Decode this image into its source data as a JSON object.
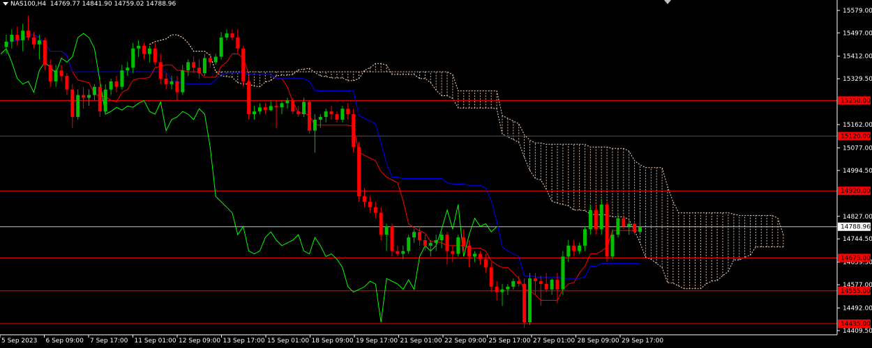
{
  "header": {
    "symbol": "NAS100,H4",
    "ohlc": "14769.77 14841.90 14759.02 14788.96"
  },
  "icons": {
    "collapse": "triangle-down-icon",
    "scroll": "scroll-indicator-icon"
  },
  "colors": {
    "background": "#000000",
    "frame": "#ffffff",
    "bull": "#00c000",
    "bear": "#ff0000",
    "tenkan": "#ff0000",
    "kijun": "#0000ff",
    "chikou": "#00ff00",
    "cloud": "#ffdab9",
    "level": "#ff0000",
    "current": "#ffffff"
  },
  "chart_data": {
    "type": "candlestick",
    "title": "NAS100,H4",
    "indicator": "Ichimoku",
    "grid": false,
    "ylim": [
      14409.5,
      15579.0
    ],
    "y_ticks": [
      "15579.00",
      "15497.00",
      "15412.00",
      "15329.50",
      "15162.00",
      "15077.00",
      "14994.50",
      "14827.00",
      "14744.50",
      "14659.50",
      "14577.00",
      "14492.00",
      "14409.50"
    ],
    "x_ticks": [
      "5 Sep 2023",
      "6 Sep 09:00",
      "7 Sep 17:00",
      "11 Sep 01:00",
      "12 Sep 09:00",
      "13 Sep 17:00",
      "15 Sep 01:00",
      "18 Sep 09:00",
      "19 Sep 17:00",
      "21 Sep 01:00",
      "22 Sep 09:00",
      "25 Sep 17:00",
      "27 Sep 01:00",
      "28 Sep 09:00",
      "29 Sep 17:00"
    ],
    "levels": [
      {
        "label": "15250.00",
        "value": 15250.0
      },
      {
        "label": "15120.00",
        "value": 15120.0
      },
      {
        "label": "14920.00",
        "value": 14920.0
      },
      {
        "label": "14675.00",
        "value": 14675.0
      },
      {
        "label": "14555.00",
        "value": 14555.0
      },
      {
        "label": "14435.00",
        "value": 14435.0
      }
    ],
    "current_price": {
      "label": "14788.96",
      "value": 14788.96
    },
    "bars": [
      {
        "o": 15445,
        "h": 15490,
        "l": 15420,
        "c": 15465
      },
      {
        "o": 15465,
        "h": 15510,
        "l": 15440,
        "c": 15490
      },
      {
        "o": 15490,
        "h": 15520,
        "l": 15450,
        "c": 15470
      },
      {
        "o": 15470,
        "h": 15530,
        "l": 15430,
        "c": 15505
      },
      {
        "o": 15505,
        "h": 15560,
        "l": 15470,
        "c": 15480
      },
      {
        "o": 15480,
        "h": 15500,
        "l": 15440,
        "c": 15455
      },
      {
        "o": 15455,
        "h": 15490,
        "l": 15400,
        "c": 15470
      },
      {
        "o": 15470,
        "h": 15480,
        "l": 15360,
        "c": 15380
      },
      {
        "o": 15380,
        "h": 15400,
        "l": 15300,
        "c": 15320
      },
      {
        "o": 15320,
        "h": 15380,
        "l": 15300,
        "c": 15360
      },
      {
        "o": 15360,
        "h": 15380,
        "l": 15320,
        "c": 15340
      },
      {
        "o": 15340,
        "h": 15350,
        "l": 15270,
        "c": 15290
      },
      {
        "o": 15290,
        "h": 15310,
        "l": 15150,
        "c": 15190
      },
      {
        "o": 15190,
        "h": 15290,
        "l": 15180,
        "c": 15270
      },
      {
        "o": 15270,
        "h": 15300,
        "l": 15220,
        "c": 15260
      },
      {
        "o": 15260,
        "h": 15290,
        "l": 15230,
        "c": 15270
      },
      {
        "o": 15270,
        "h": 15310,
        "l": 15250,
        "c": 15300
      },
      {
        "o": 15300,
        "h": 15330,
        "l": 15190,
        "c": 15210
      },
      {
        "o": 15210,
        "h": 15310,
        "l": 15200,
        "c": 15290
      },
      {
        "o": 15290,
        "h": 15330,
        "l": 15270,
        "c": 15320
      },
      {
        "o": 15320,
        "h": 15340,
        "l": 15280,
        "c": 15300
      },
      {
        "o": 15300,
        "h": 15380,
        "l": 15290,
        "c": 15360
      },
      {
        "o": 15360,
        "h": 15390,
        "l": 15340,
        "c": 15370
      },
      {
        "o": 15370,
        "h": 15460,
        "l": 15350,
        "c": 15440
      },
      {
        "o": 15440,
        "h": 15470,
        "l": 15410,
        "c": 15450
      },
      {
        "o": 15450,
        "h": 15460,
        "l": 15400,
        "c": 15420
      },
      {
        "o": 15420,
        "h": 15450,
        "l": 15390,
        "c": 15440
      },
      {
        "o": 15440,
        "h": 15460,
        "l": 15380,
        "c": 15390
      },
      {
        "o": 15390,
        "h": 15420,
        "l": 15310,
        "c": 15330
      },
      {
        "o": 15330,
        "h": 15350,
        "l": 15290,
        "c": 15310
      },
      {
        "o": 15310,
        "h": 15340,
        "l": 15290,
        "c": 15320
      },
      {
        "o": 15320,
        "h": 15340,
        "l": 15250,
        "c": 15280
      },
      {
        "o": 15280,
        "h": 15380,
        "l": 15270,
        "c": 15360
      },
      {
        "o": 15360,
        "h": 15400,
        "l": 15340,
        "c": 15390
      },
      {
        "o": 15390,
        "h": 15410,
        "l": 15350,
        "c": 15370
      },
      {
        "o": 15370,
        "h": 15400,
        "l": 15330,
        "c": 15350
      },
      {
        "o": 15350,
        "h": 15420,
        "l": 15340,
        "c": 15405
      },
      {
        "o": 15405,
        "h": 15420,
        "l": 15370,
        "c": 15390
      },
      {
        "o": 15390,
        "h": 15420,
        "l": 15380,
        "c": 15410
      },
      {
        "o": 15410,
        "h": 15500,
        "l": 15400,
        "c": 15480
      },
      {
        "o": 15480,
        "h": 15510,
        "l": 15470,
        "c": 15495
      },
      {
        "o": 15495,
        "h": 15510,
        "l": 15470,
        "c": 15480
      },
      {
        "o": 15480,
        "h": 15510,
        "l": 15420,
        "c": 15440
      },
      {
        "o": 15440,
        "h": 15450,
        "l": 15300,
        "c": 15320
      },
      {
        "o": 15320,
        "h": 15340,
        "l": 15180,
        "c": 15200
      },
      {
        "o": 15200,
        "h": 15230,
        "l": 15180,
        "c": 15210
      },
      {
        "o": 15210,
        "h": 15240,
        "l": 15200,
        "c": 15225
      },
      {
        "o": 15225,
        "h": 15240,
        "l": 15200,
        "c": 15215
      },
      {
        "o": 15215,
        "h": 15250,
        "l": 15210,
        "c": 15230
      },
      {
        "o": 15230,
        "h": 15250,
        "l": 15150,
        "c": 15225
      },
      {
        "o": 15225,
        "h": 15250,
        "l": 15200,
        "c": 15240
      },
      {
        "o": 15240,
        "h": 15260,
        "l": 15220,
        "c": 15250
      },
      {
        "o": 15250,
        "h": 15260,
        "l": 15200,
        "c": 15210
      },
      {
        "o": 15210,
        "h": 15230,
        "l": 15190,
        "c": 15200
      },
      {
        "o": 15200,
        "h": 15260,
        "l": 15190,
        "c": 15245
      },
      {
        "o": 15245,
        "h": 15250,
        "l": 15130,
        "c": 15140
      },
      {
        "o": 15140,
        "h": 15200,
        "l": 15060,
        "c": 15180
      },
      {
        "o": 15180,
        "h": 15200,
        "l": 15150,
        "c": 15190
      },
      {
        "o": 15190,
        "h": 15220,
        "l": 15170,
        "c": 15210
      },
      {
        "o": 15210,
        "h": 15230,
        "l": 15180,
        "c": 15200
      },
      {
        "o": 15200,
        "h": 15210,
        "l": 15170,
        "c": 15180
      },
      {
        "o": 15180,
        "h": 15230,
        "l": 15170,
        "c": 15220
      },
      {
        "o": 15220,
        "h": 15240,
        "l": 15180,
        "c": 15200
      },
      {
        "o": 15200,
        "h": 15220,
        "l": 15060,
        "c": 15080
      },
      {
        "o": 15080,
        "h": 15100,
        "l": 14880,
        "c": 14900
      },
      {
        "o": 14900,
        "h": 14930,
        "l": 14860,
        "c": 14880
      },
      {
        "o": 14880,
        "h": 14900,
        "l": 14840,
        "c": 14860
      },
      {
        "o": 14860,
        "h": 14880,
        "l": 14820,
        "c": 14840
      },
      {
        "o": 14840,
        "h": 14860,
        "l": 14740,
        "c": 14760
      },
      {
        "o": 14760,
        "h": 14800,
        "l": 14700,
        "c": 14790
      },
      {
        "o": 14790,
        "h": 14800,
        "l": 14680,
        "c": 14700
      },
      {
        "o": 14700,
        "h": 14720,
        "l": 14680,
        "c": 14690
      },
      {
        "o": 14690,
        "h": 14720,
        "l": 14670,
        "c": 14700
      },
      {
        "o": 14700,
        "h": 14760,
        "l": 14690,
        "c": 14750
      },
      {
        "o": 14750,
        "h": 14780,
        "l": 14730,
        "c": 14770
      },
      {
        "o": 14770,
        "h": 14790,
        "l": 14720,
        "c": 14740
      },
      {
        "o": 14740,
        "h": 14760,
        "l": 14700,
        "c": 14720
      },
      {
        "o": 14720,
        "h": 14740,
        "l": 14680,
        "c": 14730
      },
      {
        "o": 14730,
        "h": 14760,
        "l": 14700,
        "c": 14740
      },
      {
        "o": 14740,
        "h": 14770,
        "l": 14710,
        "c": 14760
      },
      {
        "o": 14760,
        "h": 14770,
        "l": 14650,
        "c": 14700
      },
      {
        "o": 14700,
        "h": 14720,
        "l": 14660,
        "c": 14690
      },
      {
        "o": 14690,
        "h": 14760,
        "l": 14680,
        "c": 14750
      },
      {
        "o": 14750,
        "h": 14780,
        "l": 14700,
        "c": 14720
      },
      {
        "o": 14720,
        "h": 14740,
        "l": 14640,
        "c": 14680
      },
      {
        "o": 14680,
        "h": 14700,
        "l": 14660,
        "c": 14690
      },
      {
        "o": 14690,
        "h": 14700,
        "l": 14650,
        "c": 14670
      },
      {
        "o": 14670,
        "h": 14690,
        "l": 14620,
        "c": 14640
      },
      {
        "o": 14640,
        "h": 14660,
        "l": 14550,
        "c": 14570
      },
      {
        "o": 14570,
        "h": 14590,
        "l": 14520,
        "c": 14550
      },
      {
        "o": 14550,
        "h": 14580,
        "l": 14500,
        "c": 14560
      },
      {
        "o": 14560,
        "h": 14580,
        "l": 14540,
        "c": 14570
      },
      {
        "o": 14570,
        "h": 14600,
        "l": 14560,
        "c": 14590
      },
      {
        "o": 14590,
        "h": 14610,
        "l": 14570,
        "c": 14580
      },
      {
        "o": 14580,
        "h": 14600,
        "l": 14420,
        "c": 14440
      },
      {
        "o": 14440,
        "h": 14620,
        "l": 14430,
        "c": 14600
      },
      {
        "o": 14600,
        "h": 14620,
        "l": 14540,
        "c": 14590
      },
      {
        "o": 14590,
        "h": 14610,
        "l": 14500,
        "c": 14580
      },
      {
        "o": 14580,
        "h": 14620,
        "l": 14550,
        "c": 14560
      },
      {
        "o": 14560,
        "h": 14600,
        "l": 14540,
        "c": 14595
      },
      {
        "o": 14595,
        "h": 14620,
        "l": 14510,
        "c": 14560
      },
      {
        "o": 14560,
        "h": 14700,
        "l": 14540,
        "c": 14680
      },
      {
        "o": 14680,
        "h": 14740,
        "l": 14660,
        "c": 14720
      },
      {
        "o": 14720,
        "h": 14740,
        "l": 14680,
        "c": 14700
      },
      {
        "o": 14700,
        "h": 14730,
        "l": 14690,
        "c": 14720
      },
      {
        "o": 14720,
        "h": 14790,
        "l": 14700,
        "c": 14780
      },
      {
        "o": 14780,
        "h": 14870,
        "l": 14760,
        "c": 14850
      },
      {
        "o": 14850,
        "h": 14870,
        "l": 14760,
        "c": 14780
      },
      {
        "o": 14780,
        "h": 14890,
        "l": 14760,
        "c": 14870
      },
      {
        "o": 14870,
        "h": 14880,
        "l": 14660,
        "c": 14680
      },
      {
        "o": 14680,
        "h": 14780,
        "l": 14670,
        "c": 14760
      },
      {
        "o": 14760,
        "h": 14840,
        "l": 14750,
        "c": 14820
      },
      {
        "o": 14820,
        "h": 14830,
        "l": 14780,
        "c": 14790
      },
      {
        "o": 14790,
        "h": 14820,
        "l": 14760,
        "c": 14800
      },
      {
        "o": 14800,
        "h": 14810,
        "l": 14760,
        "c": 14770
      },
      {
        "o": 14769.77,
        "h": 14841.9,
        "l": 14759.02,
        "c": 14788.96
      }
    ]
  }
}
